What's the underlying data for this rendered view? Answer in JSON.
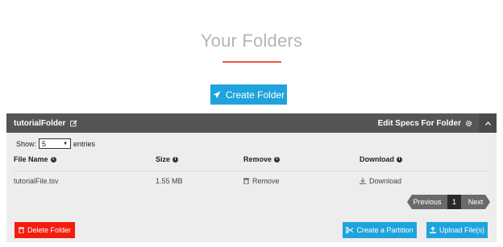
{
  "page": {
    "title": "Your Folders"
  },
  "actions": {
    "create_folder": "Create Folder"
  },
  "folder": {
    "name": "tutorialFolder",
    "edit_specs": "Edit Specs For Folder",
    "show_label": "Show:",
    "show_value": "5",
    "entries_label": "entries",
    "columns": {
      "file_name": "File Name",
      "size": "Size",
      "remove": "Remove",
      "download": "Download"
    },
    "rows": [
      {
        "file_name": "tutorialFile.tsv",
        "size": "1.55 MB",
        "remove": "Remove",
        "download": "Download"
      }
    ],
    "pager": {
      "previous": "Previous",
      "page": "1",
      "next": "Next"
    },
    "buttons": {
      "delete": "Delete Folder",
      "partition": "Create a Partition",
      "upload": "Upload File(s)"
    }
  },
  "icons": {
    "create": "rocket-icon",
    "edit": "edit-icon",
    "gear": "gear-icon",
    "collapse": "chevron-up-icon",
    "info": "info-icon",
    "trash": "trash-icon",
    "download": "download-icon",
    "scissors": "scissors-icon",
    "upload": "upload-icon"
  },
  "colors": {
    "accent": "#1fa3dc",
    "danger": "#f21d0c",
    "underline": "#ef5a3c",
    "header": "#555555"
  }
}
